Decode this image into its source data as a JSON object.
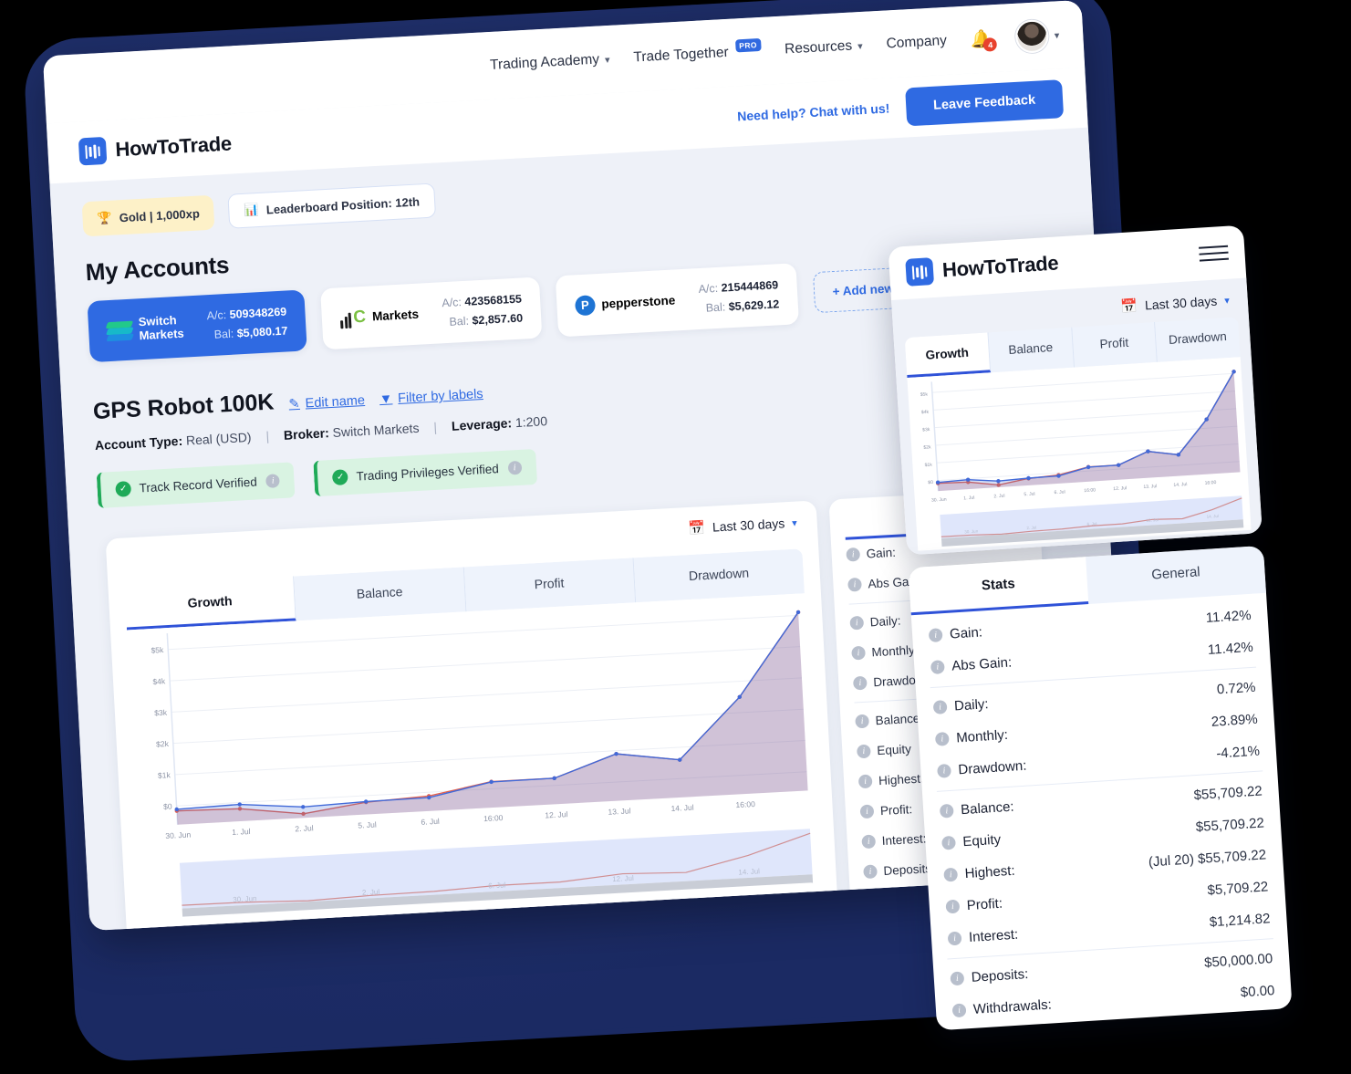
{
  "topnav": {
    "items": [
      {
        "label": "Trading Academy",
        "caret": true,
        "pro": false
      },
      {
        "label": "Trade Together",
        "caret": false,
        "pro": true,
        "pro_label": "PRO"
      },
      {
        "label": "Resources",
        "caret": true,
        "pro": false
      },
      {
        "label": "Company",
        "caret": false,
        "pro": false
      }
    ],
    "notification_count": "4"
  },
  "brand": {
    "name": "HowToTrade",
    "chat_link": "Need help? Chat with us!",
    "feedback_button": "Leave Feedback"
  },
  "chips": {
    "gold": "Gold | 1,000xp",
    "leaderboard": "Leaderboard Position: 12th"
  },
  "accounts": {
    "section_title": "My Accounts",
    "ac_label": "A/c:",
    "bal_label": "Bal:",
    "add_button": "+ Add new MT4 account",
    "cards": [
      {
        "broker": "Switch Markets",
        "broker_line1": "Switch",
        "broker_line2": "Markets",
        "account": "509348269",
        "balance": "$5,080.17",
        "active": true
      },
      {
        "broker": "IC Markets",
        "broker_line2": "Markets",
        "account": "423568155",
        "balance": "$2,857.60",
        "active": false
      },
      {
        "broker": "pepperstone",
        "account": "215444869",
        "balance": "$5,629.12",
        "active": false
      }
    ]
  },
  "robot": {
    "title": "GPS Robot 100K",
    "edit_name": "Edit name",
    "filter_labels": "Filter by labels",
    "account_type_label": "Account Type:",
    "account_type_value": "Real (USD)",
    "broker_label": "Broker:",
    "broker_value": "Switch Markets",
    "leverage_label": "Leverage:",
    "leverage_value": "1:200",
    "badges": [
      "Track Record Verified",
      "Trading Privileges Verified"
    ]
  },
  "chart_panel": {
    "range": "Last 30 days",
    "tabs": [
      "Growth",
      "Balance",
      "Profit",
      "Drawdown"
    ],
    "active_tab": "Growth"
  },
  "stats_desktop": {
    "title": "Stats",
    "rows": [
      "Gain:",
      "Abs Gain:",
      "Daily:",
      "Monthly:",
      "Drawdown:",
      "Balance:",
      "Equity",
      "Highest:",
      "Profit:",
      "Interest:",
      "Deposits:",
      "Withdrawals:"
    ]
  },
  "mobile": {
    "brand": "HowToTrade",
    "range": "Last 30 days",
    "chart_tabs": [
      "Growth",
      "Balance",
      "Profit",
      "Drawdown"
    ],
    "active_chart_tab": "Growth",
    "stat_tabs": [
      "Stats",
      "General"
    ],
    "active_stat_tab": "Stats",
    "groups": [
      [
        {
          "label": "Gain:",
          "value": "11.42%"
        },
        {
          "label": "Abs Gain:",
          "value": "11.42%"
        }
      ],
      [
        {
          "label": "Daily:",
          "value": "0.72%"
        },
        {
          "label": "Monthly:",
          "value": "23.89%"
        },
        {
          "label": "Drawdown:",
          "value": "-4.21%"
        }
      ],
      [
        {
          "label": "Balance:",
          "value": "$55,709.22"
        },
        {
          "label": "Equity",
          "value": "$55,709.22"
        },
        {
          "label": "Highest:",
          "value": "(Jul 20) $55,709.22"
        },
        {
          "label": "Profit:",
          "value": "$5,709.22"
        },
        {
          "label": "Interest:",
          "value": "$1,214.82"
        }
      ],
      [
        {
          "label": "Deposits:",
          "value": "$50,000.00"
        },
        {
          "label": "Withdrawals:",
          "value": "$0.00"
        }
      ]
    ]
  },
  "chart_data": {
    "type": "area",
    "title": "Growth",
    "xlabel": "",
    "ylabel": "",
    "ylim": [
      -600,
      5400
    ],
    "yticks": [
      "$0",
      "$1k",
      "$2k",
      "$3k",
      "$4k",
      "$5k"
    ],
    "ytick_values": [
      0,
      1000,
      2000,
      3000,
      4000,
      5000
    ],
    "x": [
      "30. Jun",
      "1. Jul",
      "2. Jul",
      "5. Jul",
      "6. Jul",
      "16:00",
      "12. Jul",
      "13. Jul",
      "14. Jul",
      "16:00"
    ],
    "grid": true,
    "legend": "none",
    "series": [
      {
        "name": "Growth",
        "color": "#4169d8",
        "values": [
          -110,
          -60,
          -250,
          -190,
          -170,
          220,
          230,
          900,
          600,
          2500,
          5100
        ]
      },
      {
        "name": "Balance",
        "color": "#e3614f",
        "values": [
          -160,
          -200,
          -470,
          -210,
          -120,
          230,
          230,
          900,
          600,
          2500,
          5100
        ]
      }
    ],
    "navigator": {
      "enabled": true,
      "label_ticks": [
        "30. Jun",
        "2. Jul",
        "6. Jul",
        "12. Jul",
        "14. Jul"
      ]
    }
  }
}
